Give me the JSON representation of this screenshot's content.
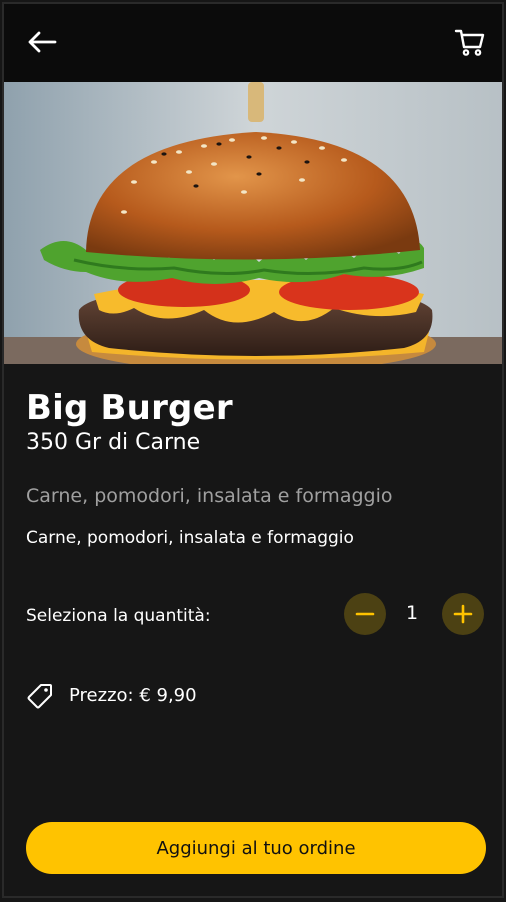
{
  "header": {
    "back_icon": "arrow-left-icon",
    "cart_icon": "shopping-cart-icon"
  },
  "product": {
    "name": "Big Burger",
    "subtitle": "350 Gr di Carne",
    "description": "Carne, pomodori, insalata e formaggio",
    "ingredients": "Carne, pomodori, insalata e formaggio"
  },
  "quantity": {
    "label": "Seleziona la quantità:",
    "value": "1",
    "minus_icon": "minus-icon",
    "plus_icon": "plus-icon"
  },
  "price": {
    "icon": "price-tag-icon",
    "text": "Prezzo: € 9,90"
  },
  "actions": {
    "add_label": "Aggiungi al tuo ordine"
  },
  "colors": {
    "accent": "#ffc300",
    "background": "#161616",
    "qty_button": "#4c4113"
  }
}
